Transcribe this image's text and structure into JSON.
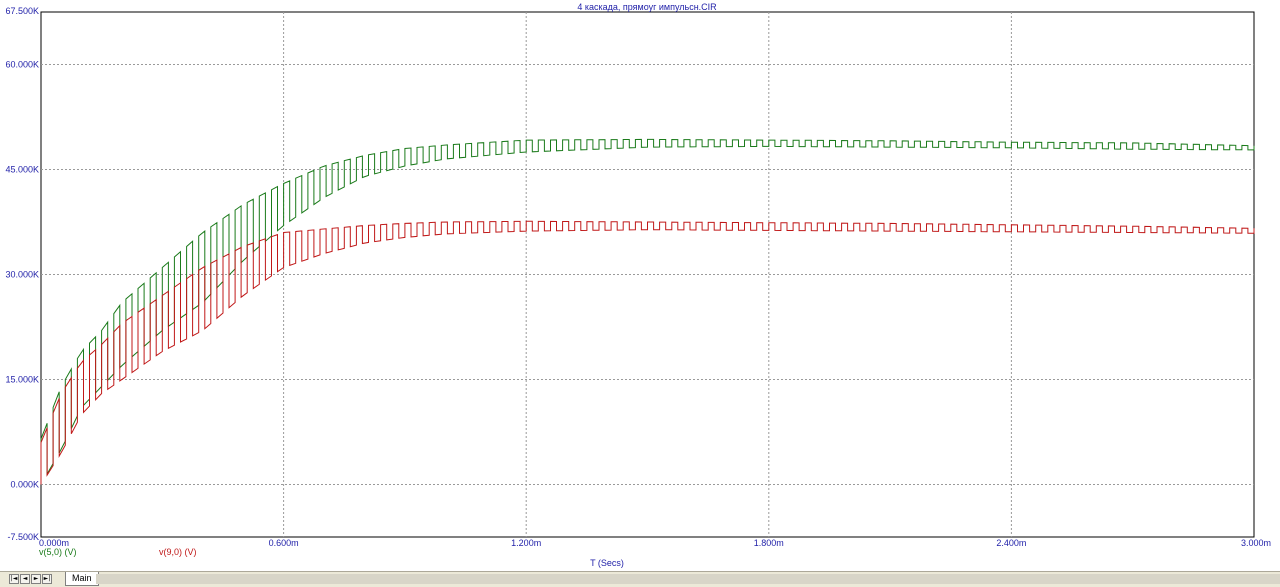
{
  "colors": {
    "grid": "#9a9a9a",
    "axis_text": "#1f1fa8",
    "series_v5": "#1a7a1a",
    "series_v9": "#c01818"
  },
  "tabs": {
    "nav": [
      "|◄",
      "◄",
      "►",
      "►|"
    ],
    "main_label": "Main"
  },
  "chart_data": {
    "type": "line",
    "title": "4 каскада, прямоуг импульсн.CIR",
    "xlabel": "T (Secs)",
    "xlim": [
      0,
      3.0
    ],
    "ylim": [
      -7.5,
      67.5
    ],
    "x_unit": "ms",
    "y_unit": "kV",
    "x_ticks": [
      0,
      0.6,
      1.2,
      1.8,
      2.4,
      3.0
    ],
    "x_tick_labels": [
      "0.000m",
      "0.600m",
      "1.200m",
      "1.800m",
      "2.400m",
      "3.000m"
    ],
    "y_ticks": [
      67.5,
      60,
      45,
      30,
      15,
      0,
      -7.5
    ],
    "y_tick_labels": [
      "67.500K",
      "60.000K",
      "45.000K",
      "30.000K",
      "15.000K",
      "0.000K",
      "-7.500K"
    ],
    "grid": true,
    "legend_position": "bottom-left",
    "series": [
      {
        "name": "v(5,0) (V)",
        "description_points": {
          "x": [
            0,
            0.05,
            0.1,
            0.15,
            0.2,
            0.3,
            0.4,
            0.5,
            0.6,
            0.7,
            0.8,
            0.9,
            1.0,
            1.2,
            1.5,
            1.8,
            2.1,
            2.4,
            2.7,
            3.0
          ],
          "envelope_high": [
            6.5,
            14,
            19,
            22,
            26,
            31,
            36,
            40,
            43,
            45.5,
            47,
            48,
            48.5,
            49.2,
            49.3,
            49.2,
            49.1,
            48.9,
            48.8,
            48.4
          ],
          "envelope_low": [
            0,
            5,
            11,
            14,
            17,
            22,
            26,
            32,
            37,
            41,
            44,
            45.5,
            46.5,
            47.5,
            48.2,
            48.3,
            48.2,
            48.1,
            47.9,
            47.8
          ]
        }
      },
      {
        "name": "v(9,0) (V)",
        "description_points": {
          "x": [
            0,
            0.05,
            0.1,
            0.15,
            0.2,
            0.3,
            0.4,
            0.5,
            0.6,
            0.7,
            0.8,
            0.9,
            1.0,
            1.2,
            1.5,
            1.8,
            2.1,
            2.4,
            2.7,
            3.0
          ],
          "envelope_high": [
            6,
            13,
            17.5,
            20,
            23,
            27,
            31,
            34,
            36,
            36.5,
            37,
            37.3,
            37.5,
            37.6,
            37.5,
            37.4,
            37.3,
            37.1,
            36.9,
            36.6
          ],
          "envelope_low": [
            0,
            4.5,
            10,
            13,
            15,
            19,
            22,
            27,
            31,
            33,
            34.5,
            35.3,
            35.8,
            36.2,
            36.4,
            36.3,
            36.2,
            36.1,
            36,
            35.9
          ]
        }
      }
    ]
  }
}
